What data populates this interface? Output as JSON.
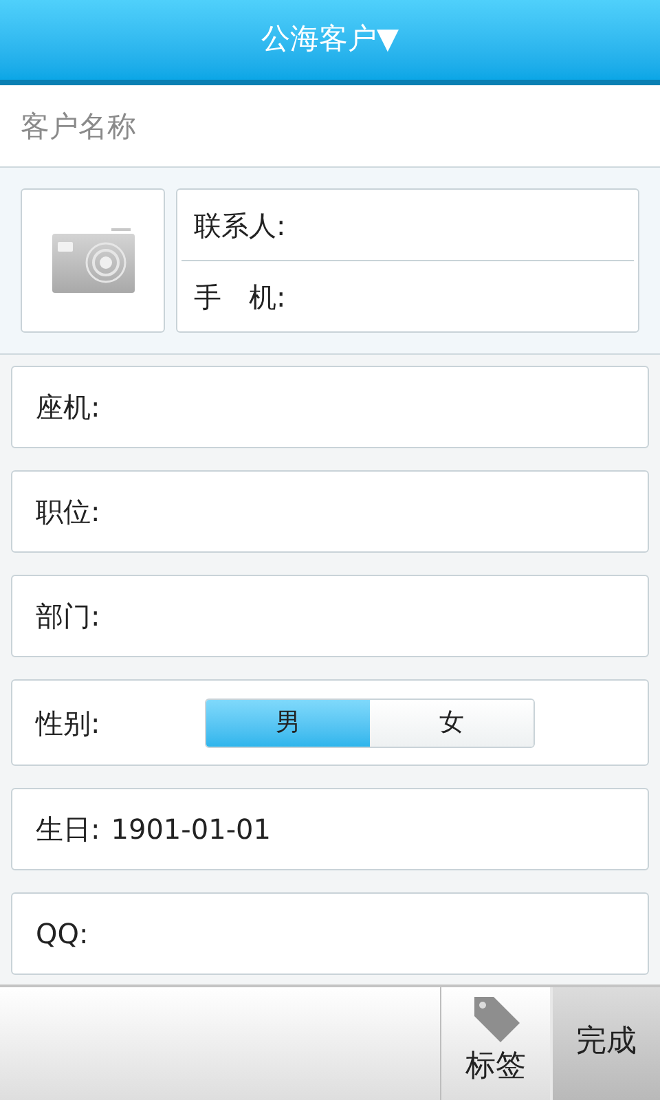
{
  "header": {
    "title": "公海客户▼"
  },
  "name_field": {
    "placeholder": "客户名称"
  },
  "contact": {
    "fields": [
      {
        "label": "联系人:"
      },
      {
        "label": "手　机:"
      }
    ]
  },
  "fields": [
    {
      "kind": "text",
      "label": "座机:"
    },
    {
      "kind": "text",
      "label": "职位:"
    },
    {
      "kind": "text",
      "label": "部门:"
    },
    {
      "kind": "choice",
      "label": "性别:",
      "options": [
        {
          "label": "男",
          "selected": true
        },
        {
          "label": "女",
          "selected": false
        }
      ]
    },
    {
      "kind": "text",
      "label": "生日:",
      "value": "1901-01-01"
    },
    {
      "kind": "text",
      "label": "QQ:"
    }
  ],
  "toolbar": {
    "tag_button": "标签",
    "done_button": "完成"
  }
}
